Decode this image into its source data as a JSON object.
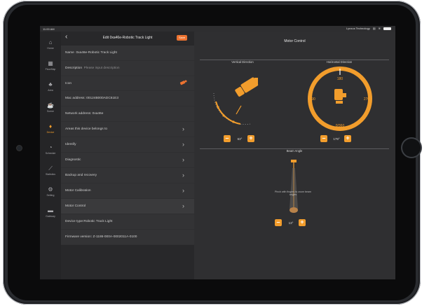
{
  "status": {
    "time": "11:00 AM",
    "carrier": "Lynxus Technology"
  },
  "sidebar": {
    "items": [
      {
        "label": "Home",
        "icon": "home-icon",
        "glyph": "⌂"
      },
      {
        "label": "FloorMap",
        "icon": "floormap-icon",
        "glyph": "▦"
      },
      {
        "label": "Area",
        "icon": "area-icon",
        "glyph": "♣"
      },
      {
        "label": "Scene",
        "icon": "scene-icon",
        "glyph": "☕"
      },
      {
        "label": "Device",
        "icon": "bulb-icon",
        "glyph": "♦"
      },
      {
        "label": "Schedule",
        "icon": "clock-icon",
        "glyph": "◔"
      },
      {
        "label": "Statistics",
        "icon": "chart-icon",
        "glyph": "⟋"
      },
      {
        "label": "Setting",
        "icon": "gear-icon",
        "glyph": "⚙"
      },
      {
        "label": "Gateway",
        "icon": "gateway-icon",
        "glyph": "▬"
      }
    ]
  },
  "header": {
    "title": "Edit 0xa46e-Robotic Track Light",
    "save": "Save"
  },
  "rows": {
    "name_label": "Name",
    "name_value": "0xa46e-Robotic Track Light",
    "description_label": "Description",
    "description_placeholder": "Please input description",
    "icon_label": "Icon",
    "mac": "Mac address: 00124B000ADC61E3",
    "network": "Network address: 0xa46e",
    "areas": "Areas this device belongs to",
    "identify": "Identify",
    "diagnostic": "Diagnostic",
    "backup": "Backup and recovery",
    "calibration": "Motor Calibration",
    "motor": "Motor Control",
    "device_type": "Device type:Robotic Track Light",
    "firmware": "Firmware version: Z-1186-000A-0002011A-0100"
  },
  "panel": {
    "title": "Motor Control",
    "vertical_label": "Vertical Direction",
    "horizontal_label": "Horizontal Direction",
    "vertical_value": "63°",
    "horizontal_value": "179°",
    "beam_label": "Beam Angle",
    "beam_hint": "Pinch with fingers to zoom beam angles",
    "beam_value": "13°",
    "compass_labels": {
      "top": "180",
      "right": "270",
      "bottom": "0/360",
      "left": "90"
    },
    "accent_color": "#f29d2c"
  }
}
